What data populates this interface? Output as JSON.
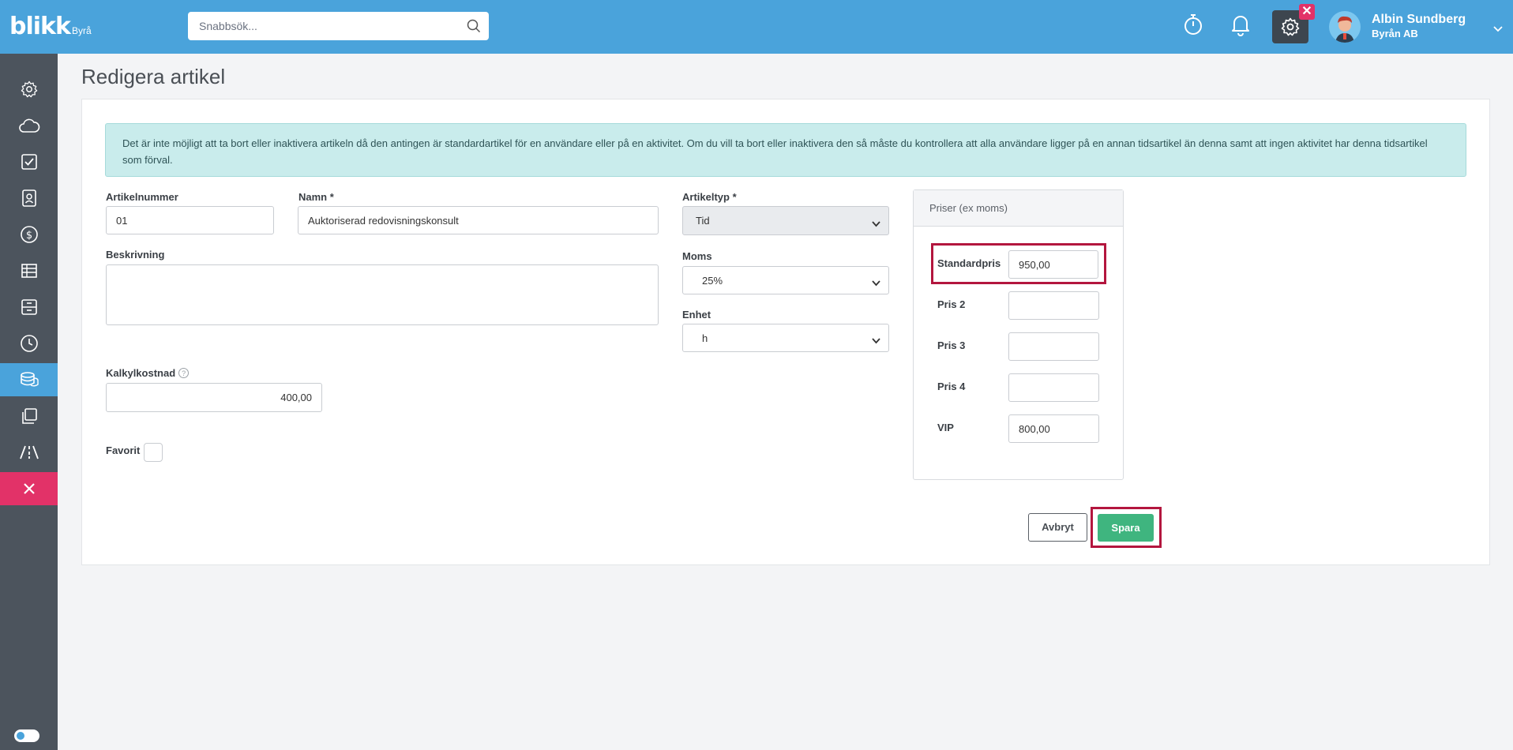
{
  "topbar": {
    "logo": "blikk",
    "logo_suffix": "Byrå",
    "search_placeholder": "Snabbsök...",
    "user_name": "Albin Sundberg",
    "user_company": "Byrån AB",
    "badge": "✕"
  },
  "sidebar": {
    "items": [
      "gear-icon",
      "cloud-icon",
      "checkbox-icon",
      "contacts-icon",
      "dollar-icon",
      "table-icon",
      "archive-icon",
      "clock-icon",
      "coins-icon",
      "copy-icon",
      "road-icon",
      "close-icon"
    ],
    "active": "coins-icon"
  },
  "page": {
    "title": "Redigera artikel",
    "alert": "Det är inte möjligt att ta bort eller inaktivera artikeln då den antingen är standardartikel för en användare eller på en aktivitet. Om du vill ta bort eller inaktivera den så måste du kontrollera att alla användare ligger på en annan tidsartikel än denna samt att ingen aktivitet har denna tidsartikel som förval."
  },
  "form": {
    "artikelnummer_label": "Artikelnummer",
    "artikelnummer_value": "01",
    "namn_label": "Namn *",
    "namn_value": "Auktoriserad redovisningskonsult",
    "beskrivning_label": "Beskrivning",
    "beskrivning_value": "",
    "kalkyl_label": "Kalkylkostnad",
    "kalkyl_help": "?",
    "kalkyl_value": "400,00",
    "favorit_label": "Favorit",
    "artikeltyp_label": "Artikeltyp *",
    "artikeltyp_value": "Tid",
    "moms_label": "Moms",
    "moms_value": "25%",
    "enhet_label": "Enhet",
    "enhet_value": "h"
  },
  "prices": {
    "header": "Priser (ex moms)",
    "standard_label": "Standardpris",
    "standard_value": "950,00",
    "pris2_label": "Pris 2",
    "pris2_value": "",
    "pris3_label": "Pris 3",
    "pris3_value": "",
    "pris4_label": "Pris 4",
    "pris4_value": "",
    "vip_label": "VIP",
    "vip_value": "800,00"
  },
  "actions": {
    "cancel": "Avbryt",
    "save": "Spara"
  },
  "colors": {
    "topbar": "#4aa3db",
    "sidebar": "#4c545d",
    "accent_pink": "#e23268",
    "save_green": "#3fb57f",
    "highlight": "#b3163e"
  }
}
